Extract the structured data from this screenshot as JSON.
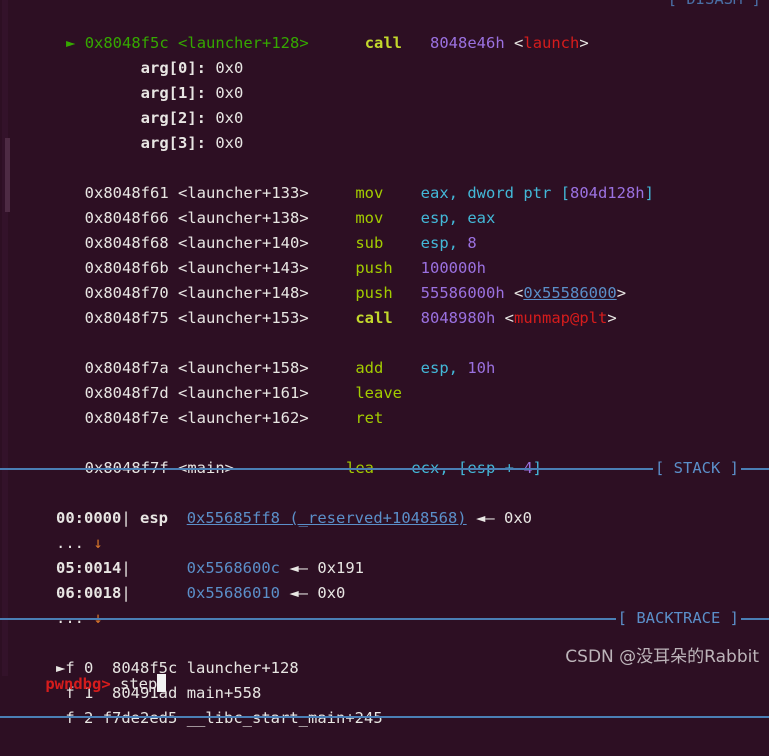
{
  "terminal": {
    "background": "#2d0f23",
    "foreground": "#e8e6e3",
    "prompt": "pwndbg> ",
    "command": "step",
    "watermark": "CSDN @没耳朵的Rabbit"
  },
  "panels": {
    "disasm": {
      "label": "[ DISASM ]"
    },
    "stack": {
      "label": "[ STACK ]"
    },
    "backtrace": {
      "label": "[ BACKTRACE ]"
    }
  },
  "disasm": {
    "current": {
      "marker": "►",
      "address": "0x8048f5c",
      "symbol": "<launcher+128>",
      "mnemonic": "call",
      "operand_num": "8048e46h",
      "operand_sym": "<launch>"
    },
    "args": [
      {
        "name": "arg[0]:",
        "value": "0x0"
      },
      {
        "name": "arg[1]:",
        "value": "0x0"
      },
      {
        "name": "arg[2]:",
        "value": "0x0"
      },
      {
        "name": "arg[3]:",
        "value": "0x0"
      }
    ],
    "lines": [
      {
        "address": "0x8048f61",
        "symbol": "<launcher+133>",
        "mnemonic": "mov",
        "op_reg": "eax, dword ptr [",
        "op_num": "804d128h",
        "op_tail": "]"
      },
      {
        "address": "0x8048f66",
        "symbol": "<launcher+138>",
        "mnemonic": "mov",
        "op_reg": "esp, eax",
        "op_num": "",
        "op_tail": ""
      },
      {
        "address": "0x8048f68",
        "symbol": "<launcher+140>",
        "mnemonic": "sub",
        "op_reg": "esp, ",
        "op_num": "8",
        "op_tail": ""
      },
      {
        "address": "0x8048f6b",
        "symbol": "<launcher+143>",
        "mnemonic": "push",
        "op_reg": "",
        "op_num": "100000h",
        "op_tail": ""
      },
      {
        "address": "0x8048f70",
        "symbol": "<launcher+148>",
        "mnemonic": "push",
        "op_reg": "",
        "op_num": "55586000h",
        "op_tail": "",
        "ref_open": "<",
        "ref_link": "0x55586000",
        "ref_close": ">"
      },
      {
        "address": "0x8048f75",
        "symbol": "<launcher+153>",
        "mnemonic": "call",
        "op_reg": "",
        "op_num": "8048980h",
        "op_tail": "",
        "ref_open": "<",
        "ref_sym": "munmap@plt",
        "ref_close": ">"
      },
      {
        "address": "0x8048f7a",
        "symbol": "<launcher+158>",
        "mnemonic": "add",
        "op_reg": "esp, ",
        "op_num": "10h",
        "op_tail": ""
      },
      {
        "address": "0x8048f7d",
        "symbol": "<launcher+161>",
        "mnemonic": "leave",
        "op_reg": "",
        "op_num": "",
        "op_tail": ""
      },
      {
        "address": "0x8048f7e",
        "symbol": "<launcher+162>",
        "mnemonic": "ret",
        "op_reg": "",
        "op_num": "",
        "op_tail": ""
      },
      {
        "address": "0x8048f7f",
        "symbol": "<main>",
        "mnemonic": "lea",
        "op_reg": "ecx, [esp + ",
        "op_num": "4",
        "op_tail": "]"
      }
    ]
  },
  "stack": {
    "rows": [
      {
        "index": "00:0000",
        "bar": "|",
        "reg": "esp",
        "address": "0x55685ff8 (_reserved+1048568)",
        "underlined": true,
        "arrow": "◄—",
        "value": "0x0"
      },
      {
        "ellipsis": "... ",
        "down": "↓"
      },
      {
        "index": "05:0014",
        "bar": "|",
        "reg": "",
        "address": "0x5568600c",
        "underlined": false,
        "arrow": "◄—",
        "value": "0x191"
      },
      {
        "index": "06:0018",
        "bar": "|",
        "reg": "",
        "address": "0x55686010",
        "underlined": false,
        "arrow": "◄—",
        "value": "0x0"
      },
      {
        "ellipsis": "... ",
        "down": "↓"
      }
    ]
  },
  "backtrace": {
    "frames": [
      {
        "marker": "►",
        "frame": "f 0",
        "address": "8048f5c",
        "symbol": "launcher+128"
      },
      {
        "marker": " ",
        "frame": "f 1",
        "address": "80491ad",
        "symbol": "main+558"
      },
      {
        "marker": " ",
        "frame": "f 2",
        "address": "f7de2ed5",
        "symbol": "__libc_start_main+245"
      }
    ]
  }
}
